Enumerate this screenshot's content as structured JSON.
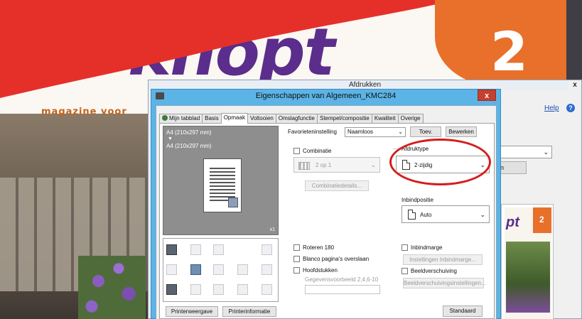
{
  "magazine": {
    "logo_text": "knopt",
    "tagline": "magazine voor",
    "issue_number": "2",
    "colors": {
      "red": "#e5302a",
      "purple": "#5b2d8c",
      "orange": "#e8702a"
    }
  },
  "print_dialog": {
    "title": "Afdrukken",
    "close_label": "x",
    "help_link": "Help",
    "help_icon": "?",
    "properties_partial_label": "n",
    "preview": {
      "logo": "pt",
      "issue_number": "2"
    }
  },
  "props_dialog": {
    "title": "Eigenschappen van Algemeen_KMC284",
    "close_label": "x",
    "tabs": [
      {
        "label": "Mijn tabblad"
      },
      {
        "label": "Basis"
      },
      {
        "label": "Opmaak"
      },
      {
        "label": "Voltooien"
      },
      {
        "label": "Omslagfunctie"
      },
      {
        "label": "Stempel/compositie"
      },
      {
        "label": "Kwaliteit"
      },
      {
        "label": "Overige"
      }
    ],
    "active_tab": "Opmaak",
    "preview": {
      "paper_line1": "A4 (210x297 mm)",
      "arrow": "▼",
      "paper_line2": "A4 (210x297 mm)",
      "count": "x1"
    },
    "favorites": {
      "label": "Favorieteninstelling",
      "value": "Naamloos",
      "add_button": "Toev.",
      "edit_button": "Bewerken"
    },
    "combination": {
      "label": "Combinatie",
      "value": "2 op 1",
      "details_button": "Combinatiedetails..."
    },
    "print_type": {
      "label": "Afdruktype",
      "value": "2-zijdig"
    },
    "binding_position": {
      "label": "Inbindpositie",
      "value": "Auto"
    },
    "rotate": {
      "label": "Roteren 180"
    },
    "skip_blank": {
      "label": "Blanco pagina's overslaan"
    },
    "chapters": {
      "label": "Hoofdstukken",
      "example": "Gegevensvoorbeeld 2,4,6-10"
    },
    "binding_margin": {
      "label": "Inbindmarge",
      "settings_button": "Instellingen Inbindmarge..."
    },
    "image_shift": {
      "label": "Beeldverschuiving",
      "settings_button": "Beeldverschuivingsinstellingen..."
    },
    "bottom_buttons": {
      "printer_view": "Printerweergave",
      "printer_info": "Printerinformatie",
      "default": "Standaard"
    }
  }
}
